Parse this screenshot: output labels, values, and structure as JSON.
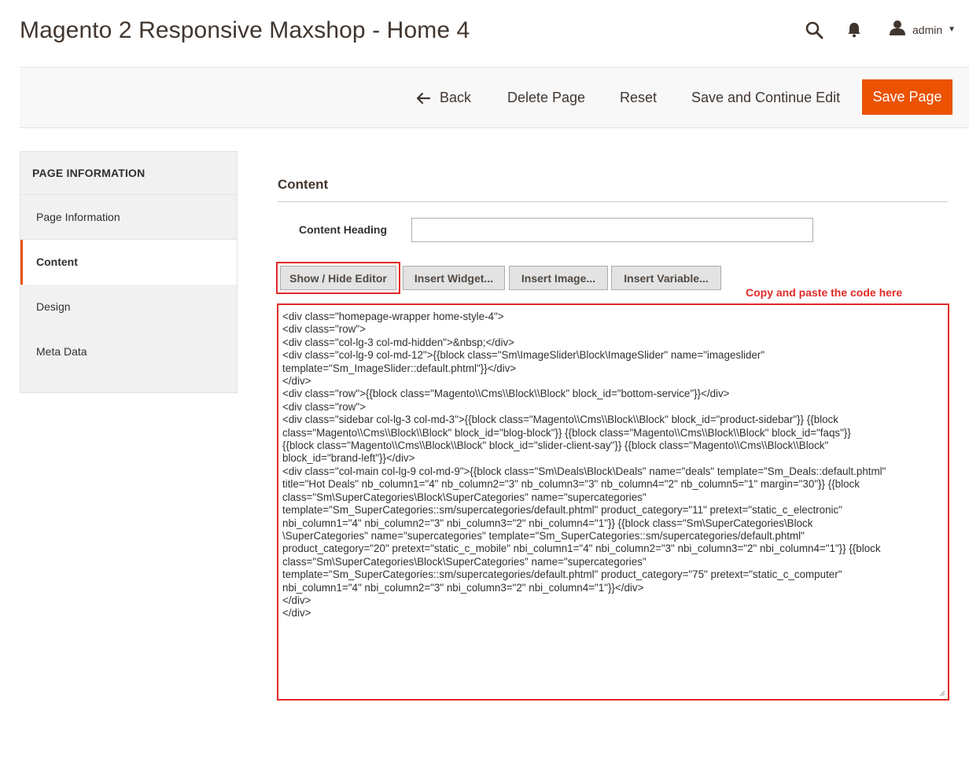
{
  "header": {
    "page_title": "Magento 2 Responsive Maxshop - Home 4",
    "user_name": "admin",
    "icons": [
      "search-icon",
      "bell-icon",
      "user-icon",
      "caret-down-icon"
    ]
  },
  "actions": {
    "back_label": "Back",
    "delete_label": "Delete Page",
    "reset_label": "Reset",
    "save_continue_label": "Save and Continue Edit",
    "save_page_label": "Save Page"
  },
  "sidebar": {
    "title": "PAGE INFORMATION",
    "items": [
      {
        "label": "Page Information",
        "active": false
      },
      {
        "label": "Content",
        "active": true
      },
      {
        "label": "Design",
        "active": false
      },
      {
        "label": "Meta Data",
        "active": false
      }
    ]
  },
  "content": {
    "section_title": "Content",
    "heading_label": "Content Heading",
    "heading_value": "",
    "buttons": {
      "show_hide": "Show / Hide Editor",
      "insert_widget": "Insert Widget...",
      "insert_image": "Insert Image...",
      "insert_variable": "Insert Variable..."
    },
    "annotation": "Copy and paste the code here",
    "code_lines": [
      "<div class=\"homepage-wrapper home-style-4\">",
      "<div class=\"row\">",
      "<div class=\"col-lg-3 col-md-hidden\">&nbsp;</div>",
      "<div class=\"col-lg-9 col-md-12\">{{block class=\"Sm\\ImageSlider\\Block\\ImageSlider\" name=\"imageslider\"",
      "template=\"Sm_ImageSlider::default.phtml\"}}</div>",
      "</div>",
      "<div class=\"row\">{{block class=\"Magento\\\\Cms\\\\Block\\\\Block\" block_id=\"bottom-service\"}}</div>",
      "<div class=\"row\">",
      "<div class=\"sidebar col-lg-3 col-md-3\">{{block class=\"Magento\\\\Cms\\\\Block\\\\Block\" block_id=\"product-sidebar\"}} {{block",
      "class=\"Magento\\\\Cms\\\\Block\\\\Block\" block_id=\"blog-block\"}} {{block class=\"Magento\\\\Cms\\\\Block\\\\Block\" block_id=\"faqs\"}}",
      "{{block class=\"Magento\\\\Cms\\\\Block\\\\Block\" block_id=\"slider-client-say\"}} {{block class=\"Magento\\\\Cms\\\\Block\\\\Block\"",
      "block_id=\"brand-left\"}}</div>",
      "<div class=\"col-main col-lg-9 col-md-9\">{{block class=\"Sm\\Deals\\Block\\Deals\" name=\"deals\" template=\"Sm_Deals::default.phtml\"",
      "title=\"Hot Deals\" nb_column1=\"4\" nb_column2=\"3\" nb_column3=\"3\" nb_column4=\"2\" nb_column5=\"1\" margin=\"30\"}} {{block",
      "class=\"Sm\\SuperCategories\\Block\\SuperCategories\" name=\"supercategories\"",
      "template=\"Sm_SuperCategories::sm/supercategories/default.phtml\" product_category=\"11\" pretext=\"static_c_electronic\"",
      "nbi_column1=\"4\" nbi_column2=\"3\" nbi_column3=\"2\" nbi_column4=\"1\"}} {{block class=\"Sm\\SuperCategories\\Block",
      "\\SuperCategories\" name=\"supercategories\" template=\"Sm_SuperCategories::sm/supercategories/default.phtml\"",
      "product_category=\"20\" pretext=\"static_c_mobile\" nbi_column1=\"4\" nbi_column2=\"3\" nbi_column3=\"2\" nbi_column4=\"1\"}} {{block",
      "class=\"Sm\\SuperCategories\\Block\\SuperCategories\" name=\"supercategories\"",
      "template=\"Sm_SuperCategories::sm/supercategories/default.phtml\" product_category=\"75\" pretext=\"static_c_computer\"",
      "nbi_column1=\"4\" nbi_column2=\"3\" nbi_column3=\"2\" nbi_column4=\"1\"}}</div>",
      "</div>",
      "</div>"
    ]
  },
  "colors": {
    "accent": "#eb5202",
    "annotation_red": "#e02b27",
    "title_text": "#41362f"
  }
}
